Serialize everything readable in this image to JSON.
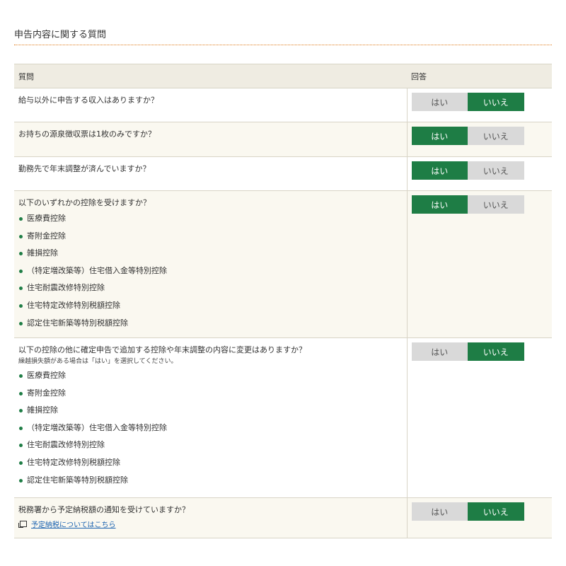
{
  "section_title": "申告内容に関する質問",
  "table": {
    "col_question": "質問",
    "col_answer": "回答"
  },
  "colors": {
    "accent_green": "#1e7d45",
    "rule_orange": "#e07b1a",
    "link_blue": "#1a62b0"
  },
  "questions": [
    {
      "text": "給与以外に申告する収入はありますか？",
      "yes": "はい",
      "no": "いいえ",
      "selected": "no"
    },
    {
      "text": "お持ちの源泉徴収票は1枚のみですか？",
      "yes": "はい",
      "no": "いいえ",
      "selected": "yes"
    },
    {
      "text": "勤務先で年末調整が済んでいますか？",
      "yes": "はい",
      "no": "いいえ",
      "selected": "yes"
    },
    {
      "text": "以下のいずれかの控除を受けますか？",
      "items": [
        "医療費控除",
        "寄附金控除",
        "雑損控除",
        "（特定増改築等）住宅借入金等特別控除",
        "住宅耐震改修特別控除",
        "住宅特定改修特別税額控除",
        "認定住宅新築等特別税額控除"
      ],
      "yes": "はい",
      "no": "いいえ",
      "selected": "yes"
    },
    {
      "text": "以下の控除の他に確定申告で追加する控除や年末調整の内容に変更はありますか？",
      "note": "繰越損失額がある場合は「はい」を選択してください。",
      "items": [
        "医療費控除",
        "寄附金控除",
        "雑損控除",
        "（特定増改築等）住宅借入金等特別控除",
        "住宅耐震改修特別控除",
        "住宅特定改修特別税額控除",
        "認定住宅新築等特別税額控除"
      ],
      "yes": "はい",
      "no": "いいえ",
      "selected": "no"
    },
    {
      "text": "税務署から予定納税額の通知を受けていますか？",
      "link": "予定納税についてはこちら",
      "link_icon": "new-window-icon",
      "yes": "はい",
      "no": "いいえ",
      "selected": "no"
    }
  ]
}
